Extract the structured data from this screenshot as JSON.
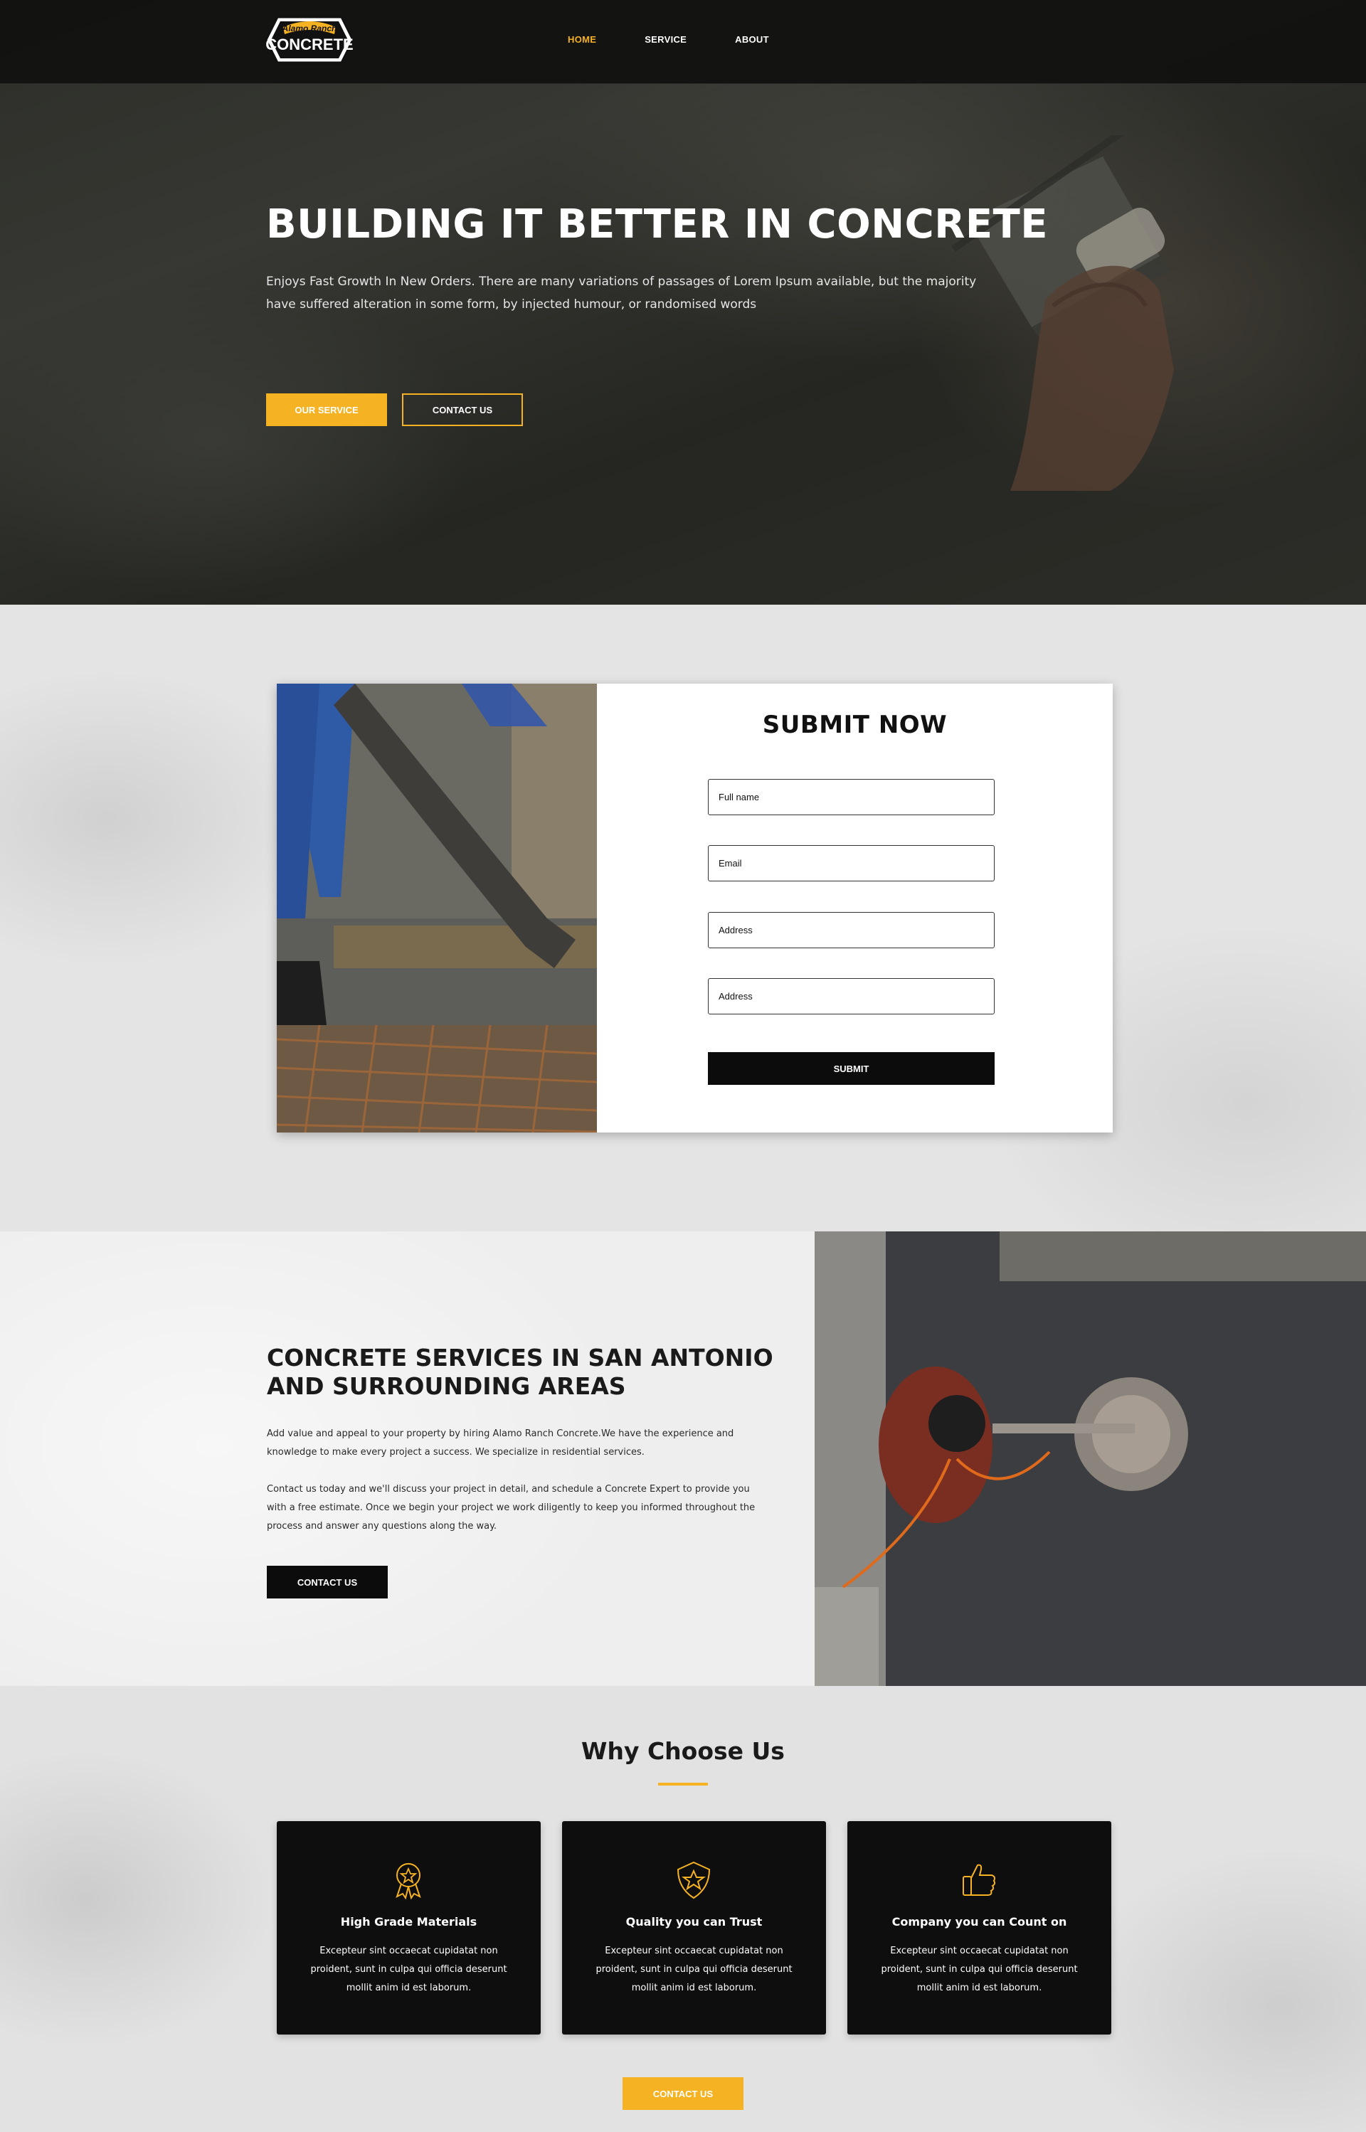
{
  "brand": {
    "logo_top": "Alamo Ranch",
    "logo_main": "CONCRETE",
    "accent": "#f5b223",
    "dark": "#0c0c0c"
  },
  "nav": {
    "items": [
      {
        "label": "HOME",
        "active": true
      },
      {
        "label": "SERVICE",
        "active": false
      },
      {
        "label": "ABOUT",
        "active": false
      }
    ]
  },
  "hero": {
    "title": "BUILDING IT BETTER IN CONCRETE",
    "text": "Enjoys Fast Growth In New Orders. There are many variations of passages of Lorem Ipsum available, but the majority have suffered alteration in some form, by injected humour, or randomised words",
    "primary_button": "OUR SERVICE",
    "secondary_button": "CONTACT US"
  },
  "form": {
    "title": "SUBMIT NOW",
    "fields": [
      "Full name",
      "Email",
      "Address",
      "Address"
    ],
    "submit_label": "SUBMIT"
  },
  "services": {
    "title": "CONCRETE SERVICES IN SAN ANTONIO AND SURROUNDING AREAS",
    "paragraph1": "Add value and appeal to your property by hiring Alamo Ranch Concrete.We have the experience and knowledge to make every project a success. We specialize in residential services.",
    "paragraph2": "Contact us today and we'll discuss your project in detail, and schedule a Concrete Expert to provide you with a free estimate. Once we begin your project we work diligently to keep you informed throughout the process and answer any questions along the way.",
    "button": "CONTACT US"
  },
  "why": {
    "title": "Why Choose Us",
    "features": [
      {
        "icon": "award-badge-icon",
        "title": "High Grade Materials",
        "text": "Excepteur sint occaecat cupidatat non proident, sunt in culpa qui officia deserunt mollit anim id est laborum."
      },
      {
        "icon": "shield-star-icon",
        "title": "Quality you can Trust",
        "text": "Excepteur sint occaecat cupidatat non proident, sunt in culpa qui officia deserunt mollit anim id est laborum."
      },
      {
        "icon": "thumbs-up-icon",
        "title": "Company you can Count on",
        "text": "Excepteur sint occaecat cupidatat non proident, sunt in culpa qui officia deserunt mollit anim id est laborum."
      }
    ],
    "button": "CONTACT US"
  }
}
